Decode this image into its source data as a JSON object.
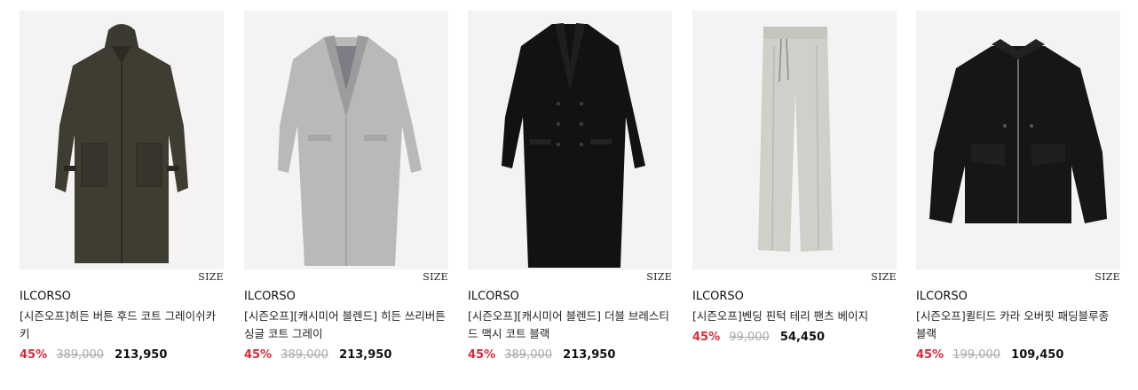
{
  "products": [
    {
      "image": "hooded-coat-khaki",
      "size_label": "SIZE",
      "brand": "ILCORSO",
      "name": "[시즌오프]히든 버튼 후드 코트 그레이쉬카키",
      "discount": "45%",
      "original_price": "389,000",
      "sale_price": "213,950"
    },
    {
      "image": "single-coat-gray",
      "size_label": "SIZE",
      "brand": "ILCORSO",
      "name": "[시즌오프][캐시미어 블렌드] 히든 쓰리버튼 싱글 코트 그레이",
      "discount": "45%",
      "original_price": "389,000",
      "sale_price": "213,950"
    },
    {
      "image": "double-coat-black",
      "size_label": "SIZE",
      "brand": "ILCORSO",
      "name": "[시즌오프][캐시미어 블렌드] 더블 브레스티드 맥시 코트 블랙",
      "discount": "45%",
      "original_price": "389,000",
      "sale_price": "213,950"
    },
    {
      "image": "pants-beige",
      "size_label": "SIZE",
      "brand": "ILCORSO",
      "name": "[시즌오프]벤딩 핀턱 테리 팬츠 베이지",
      "discount": "45%",
      "original_price": "99,000",
      "sale_price": "54,450"
    },
    {
      "image": "padded-blouson-black",
      "size_label": "SIZE",
      "brand": "ILCORSO",
      "name": "[시즌오프]퀼티드 카라 오버핏 패딩블루종 블랙",
      "discount": "45%",
      "original_price": "199,000",
      "sale_price": "109,450"
    }
  ]
}
